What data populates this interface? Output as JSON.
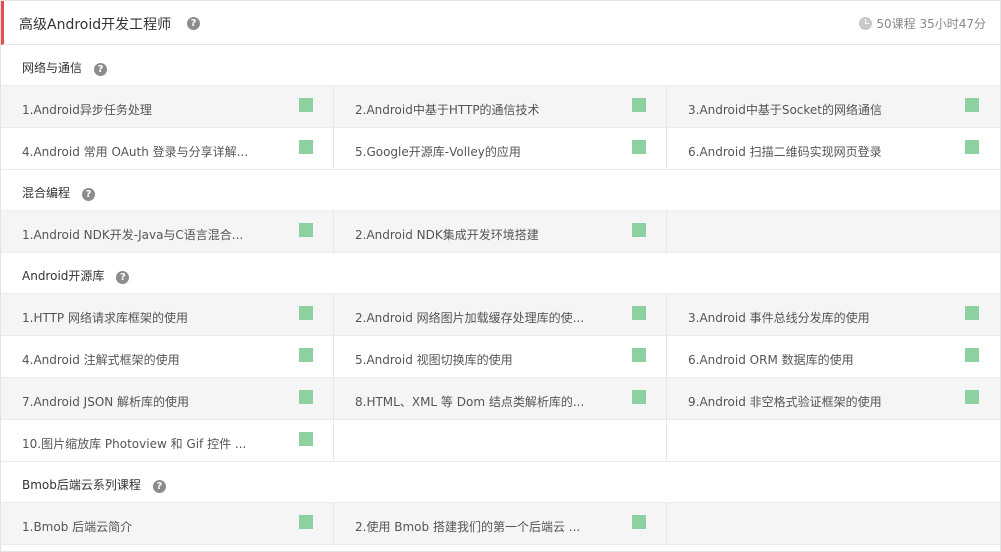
{
  "header": {
    "title": "高级Android开发工程师",
    "help_glyph": "?",
    "stats": "50课程  35小时47分"
  },
  "colors": {
    "accent_bar": "#e54c4c",
    "status_square": "#8dd1a0"
  },
  "sections": [
    {
      "title": "网络与通信",
      "rows": [
        [
          "1.Android异步任务处理",
          "2.Android中基于HTTP的通信技术",
          "3.Android中基于Socket的网络通信"
        ],
        [
          "4.Android 常用 OAuth 登录与分享详解...",
          "5.Google开源库-Volley的应用",
          "6.Android 扫描二维码实现网页登录"
        ]
      ]
    },
    {
      "title": "混合编程",
      "rows": [
        [
          "1.Android NDK开发-Java与C语言混合...",
          "2.Android NDK集成开发环境搭建",
          ""
        ]
      ]
    },
    {
      "title": "Android开源库",
      "rows": [
        [
          "1.HTTP 网络请求库框架的使用",
          "2.Android 网络图片加载缓存处理库的使...",
          "3.Android 事件总线分发库的使用"
        ],
        [
          "4.Android 注解式框架的使用",
          "5.Android 视图切换库的使用",
          "6.Android ORM 数据库的使用"
        ],
        [
          "7.Android JSON 解析库的使用",
          "8.HTML、XML 等 Dom 结点类解析库的...",
          "9.Android 非空格式验证框架的使用"
        ],
        [
          "10.图片缩放库 Photoview 和 Gif 控件 ...",
          "",
          ""
        ]
      ]
    },
    {
      "title": "Bmob后端云系列课程",
      "rows": [
        [
          "1.Bmob 后端云简介",
          "2.使用 Bmob 搭建我们的第一个后端云 ...",
          ""
        ]
      ]
    }
  ]
}
